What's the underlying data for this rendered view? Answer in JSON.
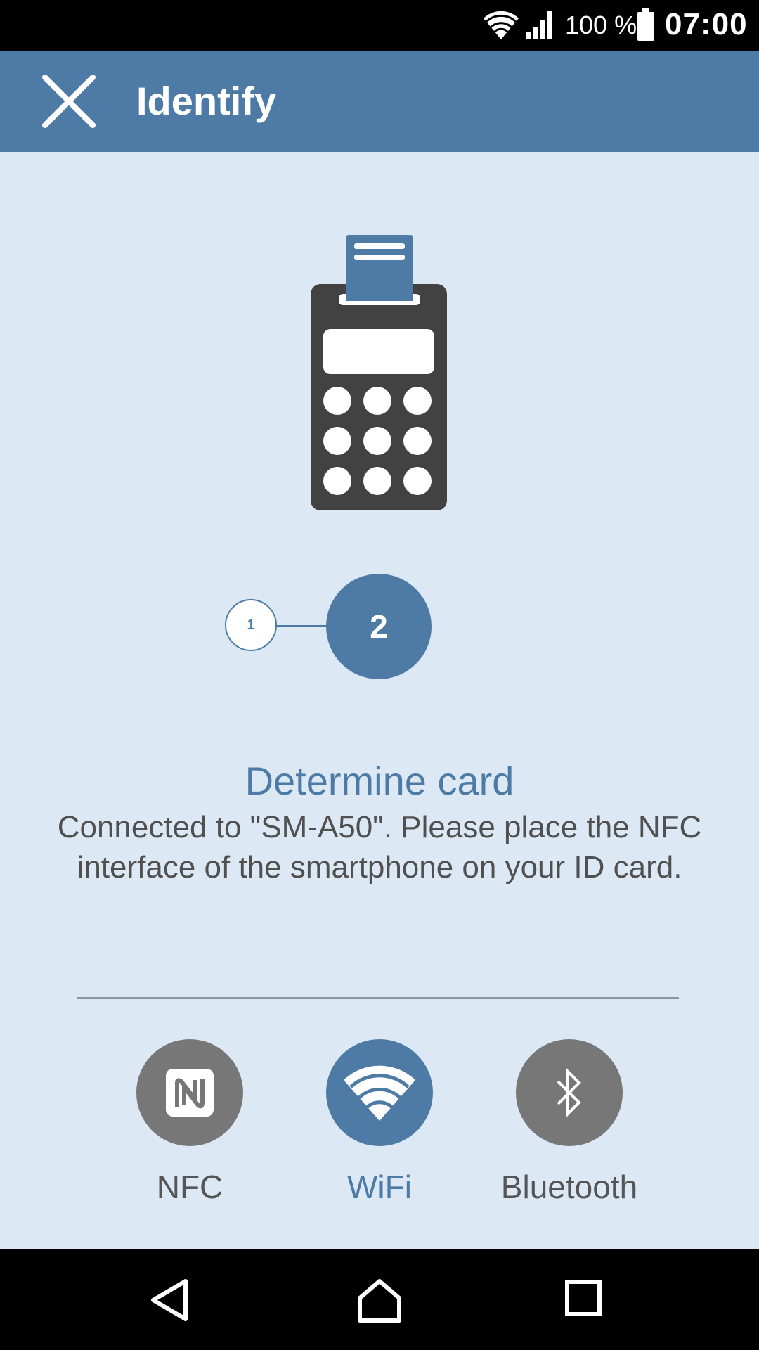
{
  "status_bar": {
    "battery_text": "100 %",
    "time": "07:00",
    "icons": [
      "wifi-icon",
      "cell-signal-icon",
      "battery-icon"
    ]
  },
  "app_bar": {
    "title": "Identify",
    "close_icon": "close-icon"
  },
  "illustration": "card-terminal-icon",
  "stepper": {
    "steps": [
      {
        "label": "1",
        "active": false
      },
      {
        "label": "2",
        "active": true
      }
    ]
  },
  "step": {
    "title": "Determine card",
    "description": "Connected to \"SM-A50\". Please place the NFC interface of the smartphone on your ID card."
  },
  "connections": [
    {
      "label": "NFC",
      "icon": "nfc-icon",
      "selected": false
    },
    {
      "label": "WiFi",
      "icon": "wifi-icon",
      "selected": true
    },
    {
      "label": "Bluetooth",
      "icon": "bluetooth-icon",
      "selected": false
    }
  ],
  "colors": {
    "accent": "#4d7ba6",
    "background": "#dce9f5",
    "inactive": "#777777",
    "terminal": "#424242"
  },
  "nav_bar": {
    "icons": [
      "back-icon",
      "home-icon",
      "recent-apps-icon"
    ]
  }
}
